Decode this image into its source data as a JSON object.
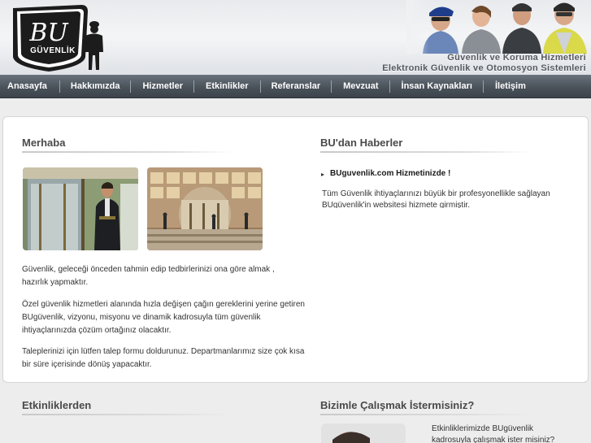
{
  "header": {
    "logo_letters": "BU",
    "logo_word": "GÜVENLİK",
    "slogan_line1": "Güvenlik ve Koruma Hizmetleri",
    "slogan_line2": "Elektronik Güvenlik ve Otomosyon Sistemleri"
  },
  "nav": {
    "items": [
      {
        "label": "Anasayfa"
      },
      {
        "label": "Hakkımızda"
      },
      {
        "label": "Hizmetler"
      },
      {
        "label": "Etkinlikler"
      },
      {
        "label": "Referanslar"
      },
      {
        "label": "Mevzuat"
      },
      {
        "label": "İnsan Kaynakları"
      },
      {
        "label": "İletişim"
      }
    ]
  },
  "welcome": {
    "title": "Merhaba",
    "paragraph1": "Güvenlik, geleceği önceden tahmin edip tedbirlerinizi ona göre almak , hazırlık yapmaktır.",
    "paragraph2": "Özel güvenlik hizmetleri alanında hızla değişen çağın gereklerini yerine getiren BUgüvenlik, vizyonu, misyonu ve dinamik kadrosuyla tüm güvenlik ihtiyaçlarınızda çözüm ortağınız olacaktır.",
    "paragraph3": "Taleplerinizi için lütfen talep formu doldurunuz. Departmanlarımız size çok kısa bir süre içerisinde dönüş yapacaktır."
  },
  "news": {
    "title": "BU'dan Haberler",
    "headline": "BUguvenlik.com Hizmetinizde !",
    "text": "Tüm Güvenlik ihtiyaçlarınızı büyük bir profesyonellikle sağlayan BUgüvenlik'in websitesi hizmete girmiştir."
  },
  "events": {
    "title": "Etkinliklerden"
  },
  "careers": {
    "title": "Bizimle Çalışmak İstermisiniz?",
    "text": "Etkinliklerimizde BUgüvenlik kadrosuyla çalışmak ister misiniz?"
  },
  "colors": {
    "nav_bg": "#4a525a",
    "title_text": "#4a4a4a",
    "page_bg": "#ededed"
  }
}
